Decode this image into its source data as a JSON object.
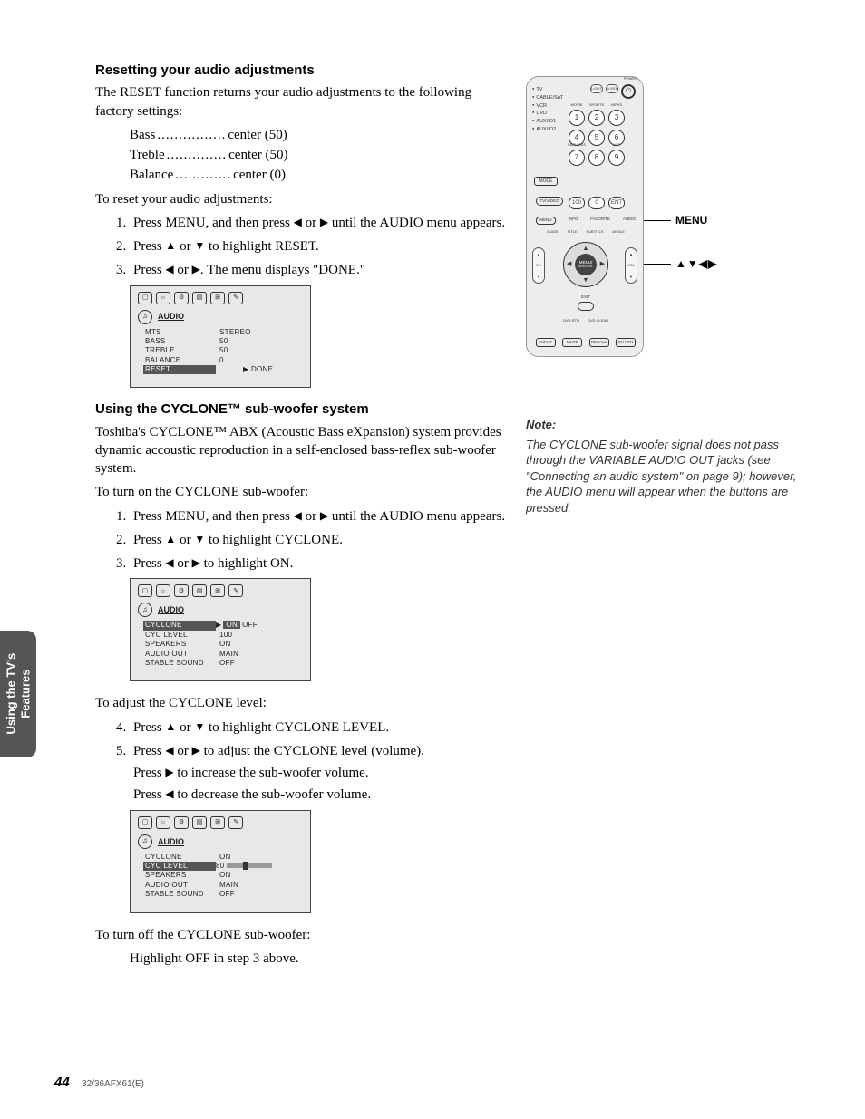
{
  "section1": {
    "heading": "Resetting your audio adjustments",
    "intro": "The RESET function returns your audio adjustments to the following factory settings:",
    "defaults": [
      {
        "name": "Bass",
        "dots": "................",
        "value": "center (50)"
      },
      {
        "name": "Treble",
        "dots": "..............",
        "value": "center (50)"
      },
      {
        "name": "Balance",
        "dots": ".............",
        "value": "center (0)"
      }
    ],
    "reset_lead": "To reset your audio adjustments:",
    "steps": [
      {
        "pre": "Press MENU, and then press ",
        "post": " until the AUDIO menu appears.",
        "mid": "left-or-right"
      },
      {
        "pre": "Press ",
        "post": " to highlight RESET.",
        "mid": "up-or-down"
      },
      {
        "pre": "Press ",
        "post": ". The menu displays \"DONE.\"",
        "mid": "left-or-right"
      }
    ],
    "menu": {
      "title": "AUDIO",
      "rows": [
        {
          "l": "MTS",
          "v": "STEREO"
        },
        {
          "l": "BASS",
          "v": "50"
        },
        {
          "l": "TREBLE",
          "v": "50"
        },
        {
          "l": "BALANCE",
          "v": "0"
        }
      ],
      "hl": {
        "l": "RESET",
        "v": "▶ DONE"
      }
    }
  },
  "section2": {
    "heading": "Using the CYCLONE™ sub-woofer system",
    "intro": "Toshiba's CYCLONE™ ABX (Acoustic Bass eXpansion) system provides dynamic accoustic reproduction in a self-enclosed bass-reflex sub-woofer system.",
    "on_lead": "To turn on the CYCLONE sub-woofer:",
    "steps_on": [
      {
        "pre": "Press MENU, and then press ",
        "post": " until the AUDIO menu appears.",
        "mid": "left-or-right"
      },
      {
        "pre": "Press ",
        "post": " to highlight CYCLONE.",
        "mid": "up-or-down"
      },
      {
        "pre": "Press ",
        "post": " to highlight ON.",
        "mid": "left-or-right"
      }
    ],
    "menu_on": {
      "title": "AUDIO",
      "hl_row": {
        "l": "CYCLONE",
        "v_on": "ON",
        "v_off": "OFF"
      },
      "rows": [
        {
          "l": "CYC LEVEL",
          "v": "100"
        },
        {
          "l": "SPEAKERS",
          "v": "ON"
        },
        {
          "l": "AUDIO OUT",
          "v": "MAIN"
        },
        {
          "l": "STABLE SOUND",
          "v": "OFF"
        }
      ]
    },
    "adj_lead": "To adjust the CYCLONE level:",
    "steps_adj": [
      {
        "n": "4.",
        "pre": "Press ",
        "post": " to highlight CYCLONE LEVEL.",
        "mid": "up-or-down"
      },
      {
        "n": "5.",
        "pre": "Press ",
        "post": " to adjust the CYCLONE level (volume).",
        "mid": "left-or-right"
      }
    ],
    "adj_sub1": {
      "pre": "Press ",
      "tri": "▶",
      "post": " to increase the sub-woofer volume."
    },
    "adj_sub2": {
      "pre": "Press ",
      "tri": "◀",
      "post": " to decrease the sub-woofer volume."
    },
    "menu_adj": {
      "title": "AUDIO",
      "rows_top": [
        {
          "l": "CYCLONE",
          "v": "ON"
        }
      ],
      "hl_row": {
        "l": "CYC LEVEL",
        "v": "80"
      },
      "rows_bot": [
        {
          "l": "SPEAKERS",
          "v": "ON"
        },
        {
          "l": "AUDIO OUT",
          "v": "MAIN"
        },
        {
          "l": "STABLE SOUND",
          "v": "OFF"
        }
      ]
    },
    "off_lead": "To turn off the CYCLONE sub-woofer:",
    "off_sub": "Highlight OFF in step 3 above."
  },
  "remote": {
    "device_list": [
      "TV",
      "CABLE/SAT",
      "VCR",
      "DVD",
      "AUX/IO1",
      "AUX/IO2"
    ],
    "top_buttons": [
      "LIGHT",
      "SLEEP"
    ],
    "power_label": "POWER",
    "num_labels_top": [
      "MOVIE",
      "SPORTS",
      "NEWS"
    ],
    "num_labels_mid": [
      "SERVICES",
      "",
      "LIST"
    ],
    "numbers": [
      "1",
      "2",
      "3",
      "4",
      "5",
      "6",
      "7",
      "8",
      "9"
    ],
    "mode": "MODE",
    "tvvideo": "TV/VIDEO",
    "row100": [
      "100",
      "0",
      "ENT"
    ],
    "mid": [
      "MENU",
      "INFO",
      "FAVORITE",
      "AUDIO"
    ],
    "sub": [
      "GUIDE",
      "TITLE",
      "SUBTITLE",
      "ANGLE"
    ],
    "center": [
      "MENU/",
      "ENTER"
    ],
    "ch": "CH",
    "vol": "VOL",
    "exit": "EXIT",
    "dvdrtn": "DVD RTN",
    "dvdclear": "DVD CLEAR",
    "bottom": [
      "INPUT",
      "MUTE",
      "RECALL",
      "CH RTN"
    ]
  },
  "callouts": {
    "menu": "MENU",
    "arrows": "▲▼◀▶"
  },
  "note": {
    "heading": "Note:",
    "body": "The CYCLONE sub-woofer signal does not pass through the VARIABLE AUDIO OUT jacks (see \"Connecting an audio system\" on page 9); however, the AUDIO menu will appear when the buttons are pressed."
  },
  "sidebar": {
    "line1": "Using the TV's",
    "line2": "Features"
  },
  "footer": {
    "page": "44",
    "doc": "32/36AFX61(E)"
  },
  "glyphs": {
    "left": "◀",
    "right": "▶",
    "up": "▲",
    "down": "▼",
    "or": " or "
  }
}
